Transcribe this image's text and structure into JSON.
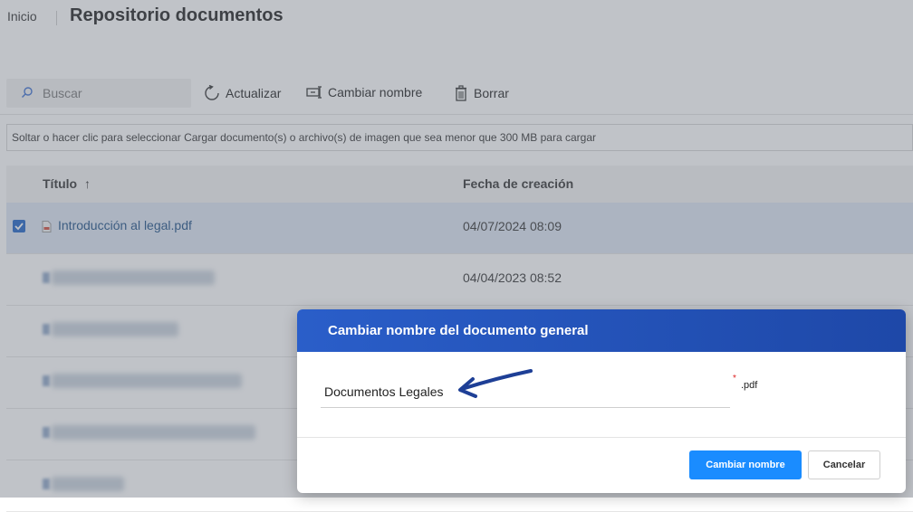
{
  "header": {
    "breadcrumb": "Inicio",
    "title": "Repositorio documentos"
  },
  "toolbar": {
    "search_placeholder": "Buscar",
    "refresh_label": "Actualizar",
    "rename_label": "Cambiar nombre",
    "delete_label": "Borrar"
  },
  "upload": {
    "hint": "Soltar o hacer clic para seleccionar Cargar documento(s) o archivo(s) de imagen que sea menor que 300 MB para cargar"
  },
  "table": {
    "columns": {
      "title": "Título",
      "title_sort": "↑",
      "created": "Fecha de creación"
    },
    "rows": [
      {
        "name": "Introducción al legal.pdf",
        "date": "04/07/2024 08:09",
        "selected": true
      },
      {
        "name": "",
        "date": "04/04/2023 08:52",
        "selected": false
      },
      {
        "name": "",
        "date": "",
        "selected": false
      },
      {
        "name": "",
        "date": "",
        "selected": false
      },
      {
        "name": "",
        "date": "",
        "selected": false
      },
      {
        "name": "",
        "date": "",
        "selected": false
      }
    ]
  },
  "modal": {
    "title": "Cambiar nombre del documento general",
    "field_value": "Documentos Legales",
    "required_mark": "*",
    "extension": ".pdf",
    "confirm_label": "Cambiar nombre",
    "cancel_label": "Cancelar"
  },
  "colors": {
    "modal_header": "#2a5ec9",
    "primary_button": "#1a8cff",
    "selected_row": "#dde6f3",
    "arrow": "#1e3f96"
  }
}
